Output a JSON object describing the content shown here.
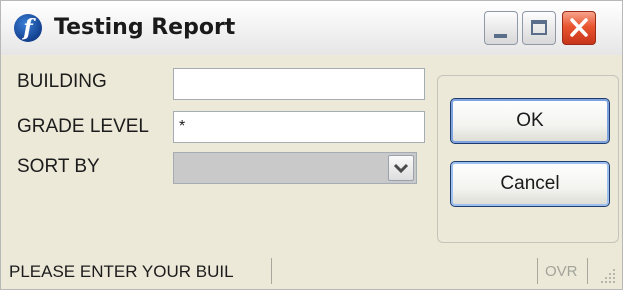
{
  "window": {
    "title": "Testing Report",
    "app_icon": "f-logo-icon",
    "controls": [
      "minimize-icon",
      "maximize-icon",
      "close-icon"
    ]
  },
  "form": {
    "building_label": "BUILDING",
    "building_value": "",
    "grade_label": "GRADE LEVEL",
    "grade_value": "*",
    "sort_label": "SORT BY",
    "sort_value": ""
  },
  "buttons": {
    "ok_label": "OK",
    "cancel_label": "Cancel"
  },
  "status": {
    "message": "PLEASE ENTER YOUR BUIL",
    "mode": "OVR"
  },
  "colors": {
    "window_bg": "#ece9d8",
    "close_button": "#e8552f",
    "button_border": "#1f3c6e"
  }
}
